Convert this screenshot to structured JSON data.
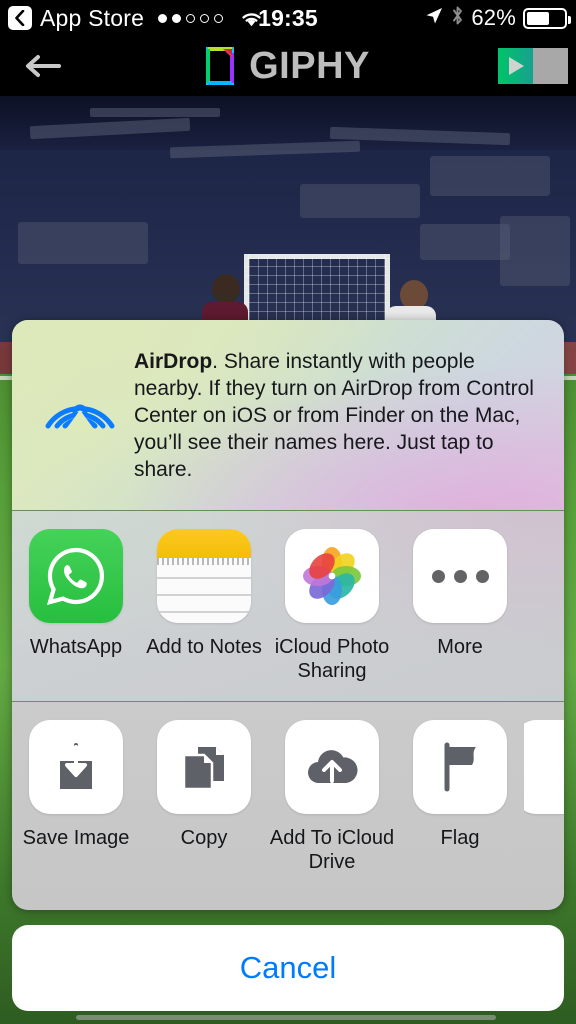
{
  "status_bar": {
    "back_label": "App Store",
    "back_icon": "chevron-left-icon",
    "signal_dots_filled": 2,
    "signal_dots_total": 5,
    "wifi_icon": "wifi-icon",
    "time": "19:35",
    "location_icon": "location-arrow-icon",
    "bluetooth_icon": "bluetooth-icon",
    "battery_percent": "62%",
    "battery_level": 62
  },
  "nav_bar": {
    "back_icon": "arrow-left-icon",
    "logo_icon": "giphy-logo-icon",
    "title": "GIPHY",
    "toggle_icon": "play-icon",
    "toggle_name": "gif-play-toggle"
  },
  "content": {
    "media_description": "Soccer match clip in stadium"
  },
  "share_sheet": {
    "airdrop": {
      "icon": "airdrop-icon",
      "title": "AirDrop",
      "body": ". Share instantly with people nearby. If they turn on AirDrop from Control Center on iOS or from Finder on the Mac, you’ll see their names here. Just tap to share."
    },
    "apps": [
      {
        "label": "WhatsApp",
        "icon": "whatsapp-icon"
      },
      {
        "label": "Add to Notes",
        "icon": "notes-icon"
      },
      {
        "label": "iCloud Photo Sharing",
        "icon": "photos-icon"
      },
      {
        "label": "More",
        "icon": "more-ellipsis-icon"
      }
    ],
    "actions": [
      {
        "label": "Save Image",
        "icon": "save-image-icon"
      },
      {
        "label": "Copy",
        "icon": "copy-icon"
      },
      {
        "label": "Add To iCloud Drive",
        "icon": "icloud-upload-icon"
      },
      {
        "label": "Flag",
        "icon": "flag-icon"
      },
      {
        "label": "",
        "icon": "partial-action-icon"
      }
    ],
    "cancel_label": "Cancel"
  },
  "colors": {
    "accent_blue": "#007aff",
    "airdrop_blue": "#0a84ff",
    "whatsapp_green": "#27bf3f",
    "notes_yellow": "#fbc91f",
    "toggle_green": "#00c46a"
  }
}
